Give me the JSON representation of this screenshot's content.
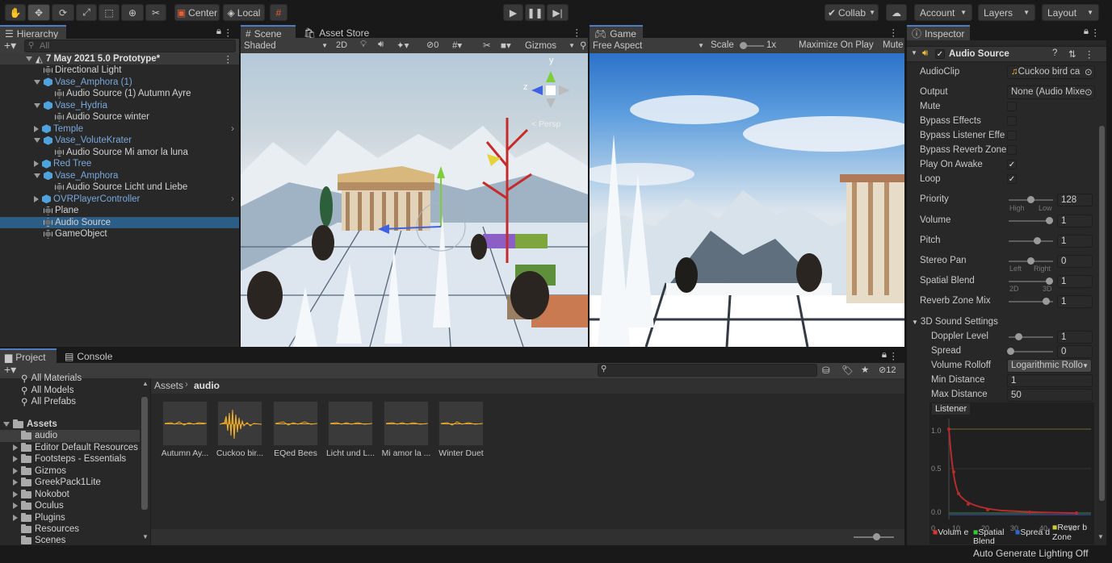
{
  "toolbar": {
    "pivot_label": "Center",
    "space_label": "Local",
    "collab_label": "Collab",
    "account_label": "Account",
    "layers_label": "Layers",
    "layout_label": "Layout"
  },
  "hierarchy": {
    "tab": "Hierarchy",
    "search_placeholder": "All",
    "scene_name": "7 May 2021 5.0 Prototype*",
    "items": [
      {
        "label": "Directional Light"
      },
      {
        "label": "Vase_Amphora (1)"
      },
      {
        "label": "Audio Source (1) Autumn Ayre"
      },
      {
        "label": "Vase_Hydria"
      },
      {
        "label": "Audio Source winter"
      },
      {
        "label": "Temple"
      },
      {
        "label": "Vase_VoluteKrater"
      },
      {
        "label": "Audio Source Mi amor la luna"
      },
      {
        "label": "Red Tree"
      },
      {
        "label": "Vase_Amphora"
      },
      {
        "label": "Audio Source Licht und Liebe"
      },
      {
        "label": "OVRPlayerController"
      },
      {
        "label": "Plane"
      },
      {
        "label": "Audio Source"
      },
      {
        "label": "GameObject"
      }
    ]
  },
  "scene": {
    "tab": "Scene",
    "tab2": "Asset Store",
    "shading": "Shaded",
    "mode_2d": "2D",
    "hidden_count": "0",
    "gizmos": "Gizmos",
    "persp": "< Persp"
  },
  "game": {
    "tab": "Game",
    "aspect": "Free Aspect",
    "scale_label": "Scale",
    "scale_value": "1x",
    "maximize": "Maximize On Play",
    "mute": "Mute"
  },
  "inspector": {
    "tab": "Inspector",
    "component": "Audio Source",
    "props": {
      "audioclip_label": "AudioClip",
      "audioclip_value": "Cuckoo bird ca",
      "output_label": "Output",
      "output_value": "None (Audio Mixe",
      "mute": "Mute",
      "bypass_effects": "Bypass Effects",
      "bypass_listener": "Bypass Listener Effe",
      "bypass_reverb": "Bypass Reverb Zone",
      "play_on_awake": "Play On Awake",
      "loop": "Loop",
      "priority": "Priority",
      "priority_value": "128",
      "high": "High",
      "low": "Low",
      "volume": "Volume",
      "volume_value": "1",
      "pitch": "Pitch",
      "pitch_value": "1",
      "stereo_pan": "Stereo Pan",
      "stereo_pan_value": "0",
      "left": "Left",
      "right": "Right",
      "spatial_blend": "Spatial Blend",
      "spatial_blend_value": "1",
      "twod": "2D",
      "threed": "3D",
      "reverb_mix": "Reverb Zone Mix",
      "reverb_mix_value": "1"
    },
    "sound3d": {
      "header": "3D Sound Settings",
      "doppler": "Doppler Level",
      "doppler_value": "1",
      "spread": "Spread",
      "spread_value": "0",
      "rolloff": "Volume Rolloff",
      "rolloff_value": "Logarithmic Rollo",
      "min_distance": "Min Distance",
      "min_distance_value": "1",
      "max_distance": "Max Distance",
      "max_distance_value": "50"
    },
    "graph": {
      "listener": "Listener",
      "y_ticks": [
        "1.0",
        "0.5",
        "0.0"
      ],
      "x_ticks": [
        "0",
        "10",
        "20",
        "30",
        "40",
        "50"
      ],
      "legend": [
        "Volum e",
        "Spatial Blend",
        "Sprea d",
        "Rever b Zone"
      ]
    }
  },
  "project": {
    "tab": "Project",
    "tab2": "Console",
    "favorites": [
      "All Materials",
      "All Models",
      "All Prefabs"
    ],
    "assets_root": "Assets",
    "folders": [
      "audio",
      "Editor Default Resources",
      "Footsteps - Essentials",
      "Gizmos",
      "GreekPack1Lite",
      "Nokobot",
      "Oculus",
      "Plugins",
      "Resources",
      "Scenes"
    ],
    "breadcrumb_root": "Assets",
    "breadcrumb_sub": "audio",
    "hidden_count": "12",
    "assets": [
      "Autumn Ay...",
      "Cuckoo bir...",
      "EQed Bees",
      "Licht und L...",
      "Mi amor la ...",
      "Winter Duet"
    ]
  },
  "status": {
    "text": "Auto Generate Lighting Off"
  }
}
